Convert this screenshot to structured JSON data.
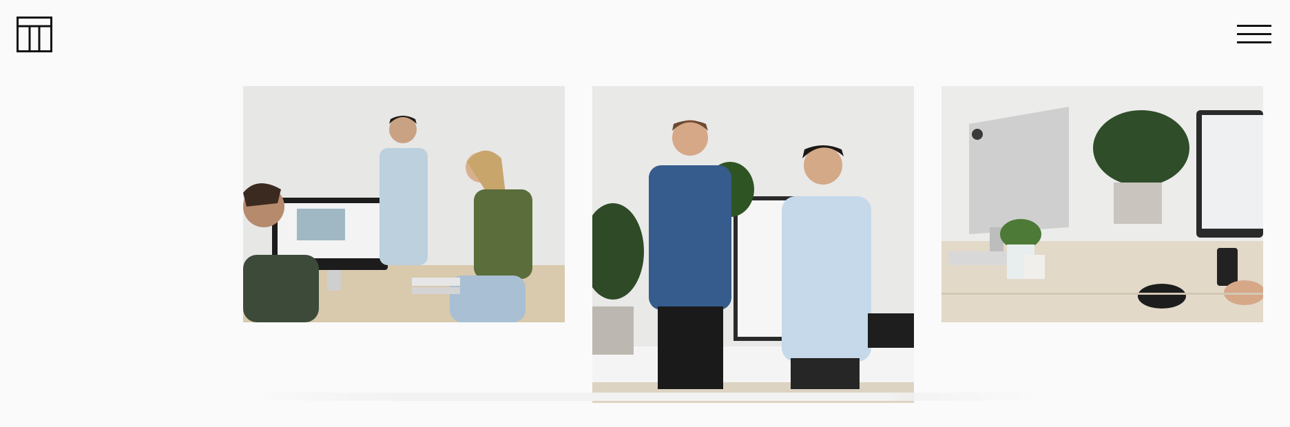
{
  "header": {
    "logo_icon": "t-monogram-logo-icon",
    "menu_icon": "hamburger-menu-icon"
  },
  "gallery": {
    "photos": [
      {
        "icon": "photo-team-meeting-at-computer"
      },
      {
        "icon": "photo-two-men-smiling"
      },
      {
        "icon": "photo-desk-with-imac-and-plants"
      }
    ]
  },
  "colors": {
    "background": "#fafafa",
    "logo_stroke": "#111111",
    "menu_bar": "#111111"
  }
}
